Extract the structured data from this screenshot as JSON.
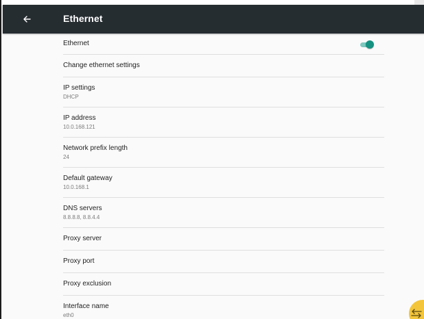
{
  "header": {
    "title": "Ethernet",
    "back_icon": "arrow-back-icon"
  },
  "ethernet_toggle": {
    "label": "Ethernet",
    "state": "on",
    "accent_color": "#159281"
  },
  "items": {
    "change_settings": {
      "title": "Change ethernet settings"
    },
    "ip_settings": {
      "title": "IP settings",
      "summary": "DHCP"
    },
    "ip_address": {
      "title": "IP address",
      "summary": "10.0.168.121"
    },
    "prefix_length": {
      "title": "Network prefix length",
      "summary": "24"
    },
    "gateway": {
      "title": "Default gateway",
      "summary": "10.0.168.1"
    },
    "dns": {
      "title": "DNS servers",
      "summary": "8.8.8.8, 8.8.4.4"
    },
    "proxy_server": {
      "title": "Proxy server"
    },
    "proxy_port": {
      "title": "Proxy port"
    },
    "proxy_exclusion": {
      "title": "Proxy exclusion"
    },
    "interface_name": {
      "title": "Interface name",
      "summary": "eth0"
    }
  },
  "overlay": {
    "fab_icon": "swap-arrows-icon",
    "fab_color": "#f3c53b"
  }
}
